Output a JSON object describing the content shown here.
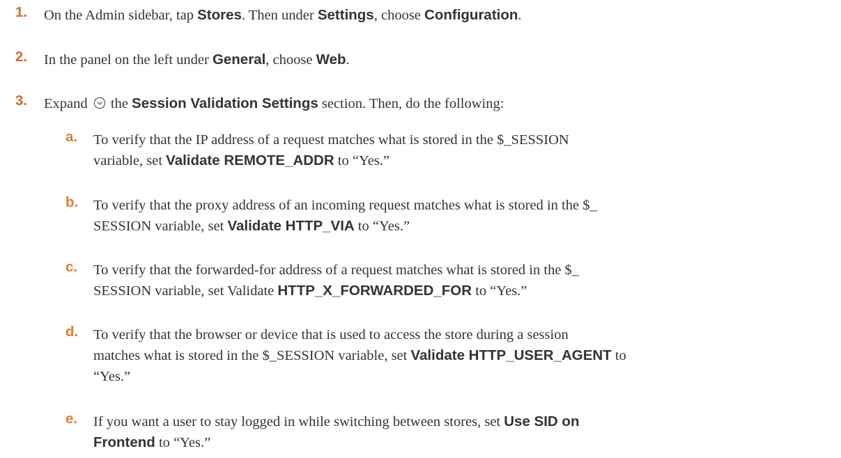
{
  "accent_color": "#d46a2b",
  "steps": [
    {
      "num": "1.",
      "t0": "On the Admin sidebar, tap ",
      "b0": "Stores",
      "t1": ". Then under ",
      "b1": "Settings",
      "t2": ", choose ",
      "b2": "Configuration",
      "t3": "."
    },
    {
      "num": "2.",
      "t0": "In the panel on the left under ",
      "b0": "General",
      "t1": ", choose ",
      "b1": "Web",
      "t2": "."
    },
    {
      "num": "3.",
      "t0": "Expand ",
      "icon": "expand-circle-chevron-icon",
      "t1": " the ",
      "b0": "Session Validation Settings",
      "t2": " section. Then, do the following:"
    }
  ],
  "substeps": [
    {
      "letter": "a.",
      "l1": "To verify that the IP address of a request matches what is stored in the $_SESSION",
      "l2a": "variable, set ",
      "b": "Validate REMOTE_ADDR",
      "l2b": " to “Yes.”"
    },
    {
      "letter": "b.",
      "l1": "To verify that the proxy address of an incoming request matches what is stored in the $_",
      "l2a": "SESSION variable, set ",
      "b": "Validate HTTP_VIA",
      "l2b": " to “Yes.”"
    },
    {
      "letter": "c.",
      "l1": "To verify that the forwarded-for address of a request matches what is stored in the $_",
      "l2a": "SESSION variable, set Validate ",
      "b": "HTTP_X_FORWARDED_FOR",
      "l2b": " to “Yes.”"
    },
    {
      "letter": "d.",
      "l1": "To verify that the browser or device that is used to access the store during a session",
      "l2a": "matches what is stored in the $_SESSION variable, set ",
      "b": "Validate HTTP_USER_AGENT",
      "l2b": " to",
      "l3": "“Yes.”"
    },
    {
      "letter": "e.",
      "l1a": "If you want a user to stay logged in while switching between stores, set ",
      "b1": "Use SID on",
      "b2": "Frontend",
      "l2b": " to “Yes.”"
    }
  ]
}
